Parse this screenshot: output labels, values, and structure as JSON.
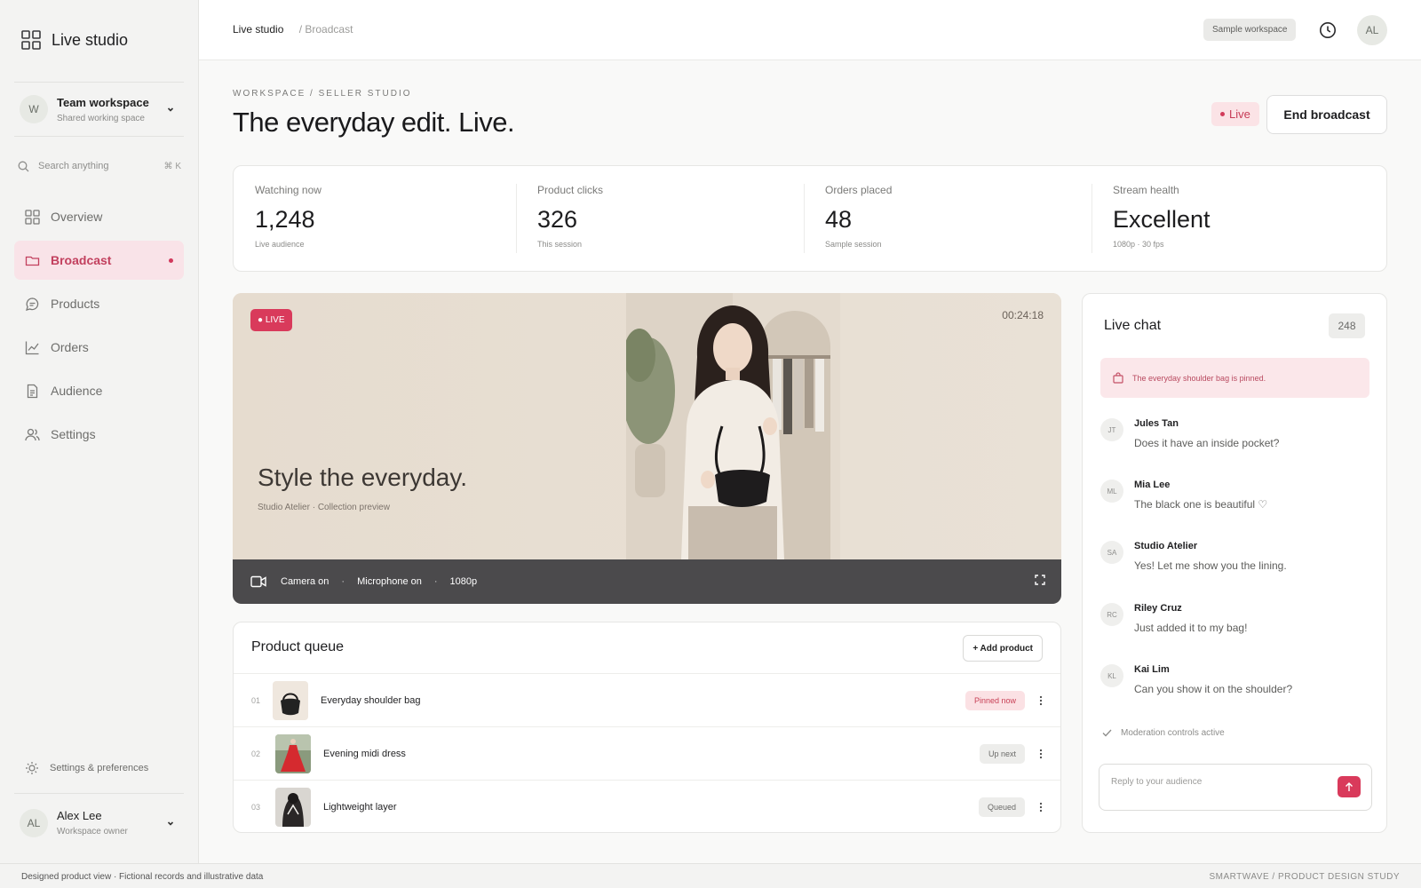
{
  "app": {
    "name": "Live studio"
  },
  "workspace": {
    "initial": "W",
    "name": "Team workspace",
    "subtitle": "Shared working space"
  },
  "search": {
    "placeholder": "Search anything",
    "shortcut": "⌘ K"
  },
  "nav": {
    "items": [
      {
        "label": "Overview",
        "icon": "grid-icon"
      },
      {
        "label": "Broadcast",
        "icon": "folder-icon",
        "active": true
      },
      {
        "label": "Products",
        "icon": "chat-bubble-icon"
      },
      {
        "label": "Orders",
        "icon": "line-chart-icon"
      },
      {
        "label": "Audience",
        "icon": "document-icon"
      },
      {
        "label": "Settings",
        "icon": "users-icon"
      }
    ]
  },
  "prefs_label": "Settings & preferences",
  "user": {
    "initials": "AL",
    "name": "Alex Lee",
    "role": "Workspace owner"
  },
  "topbar": {
    "crumb_root": "Live studio",
    "crumb_current": "/ Broadcast",
    "workspace_chip": "Sample workspace",
    "avatar_initials": "AL"
  },
  "header": {
    "eyebrow": "WORKSPACE / SELLER STUDIO",
    "title": "The everyday edit. Live.",
    "live_label": "Live",
    "end_button": "End broadcast"
  },
  "stats": [
    {
      "label": "Watching now",
      "value": "1,248",
      "sub": "Live audience"
    },
    {
      "label": "Product clicks",
      "value": "326",
      "sub": "This session"
    },
    {
      "label": "Orders placed",
      "value": "48",
      "sub": "Sample session"
    },
    {
      "label": "Stream health",
      "value": "Excellent",
      "sub": "1080p · 30 fps"
    }
  ],
  "video": {
    "live_badge": "● LIVE",
    "timer": "00:24:18",
    "tagline": "Style the everyday.",
    "collection": "Studio Atelier · Collection preview",
    "camera": "Camera on",
    "microphone": "Microphone on",
    "resolution": "1080p",
    "separator": "·"
  },
  "queue": {
    "title": "Product queue",
    "add_button": "+ Add product",
    "items": [
      {
        "num": "01",
        "name": "Everyday shoulder bag",
        "status": "Pinned now"
      },
      {
        "num": "02",
        "name": "Evening midi dress",
        "status": "Up next"
      },
      {
        "num": "03",
        "name": "Lightweight layer",
        "status": "Queued"
      }
    ]
  },
  "chat": {
    "title": "Live chat",
    "count": "248",
    "pinned": "The everyday shoulder bag is pinned.",
    "messages": [
      {
        "initials": "JT",
        "name": "Jules Tan",
        "text": "Does it have an inside pocket?"
      },
      {
        "initials": "ML",
        "name": "Mia Lee",
        "text": "The black one is beautiful ♡"
      },
      {
        "initials": "SA",
        "name": "Studio Atelier",
        "text": "Yes! Let me show you the lining."
      },
      {
        "initials": "RC",
        "name": "Riley Cruz",
        "text": "Just added it to my bag!"
      },
      {
        "initials": "KL",
        "name": "Kai Lim",
        "text": "Can you show it on the shoulder?"
      }
    ],
    "moderation": "Moderation controls active",
    "reply_placeholder": "Reply to your audience"
  },
  "footer": {
    "left": "Designed product view · Fictional records and illustrative data",
    "right": "SMARTWAVE / PRODUCT DESIGN STUDY"
  },
  "colors": {
    "accent": "#d93a5b",
    "accent_soft": "#f9e3e8",
    "dark_bar": "#4b4a4c"
  }
}
